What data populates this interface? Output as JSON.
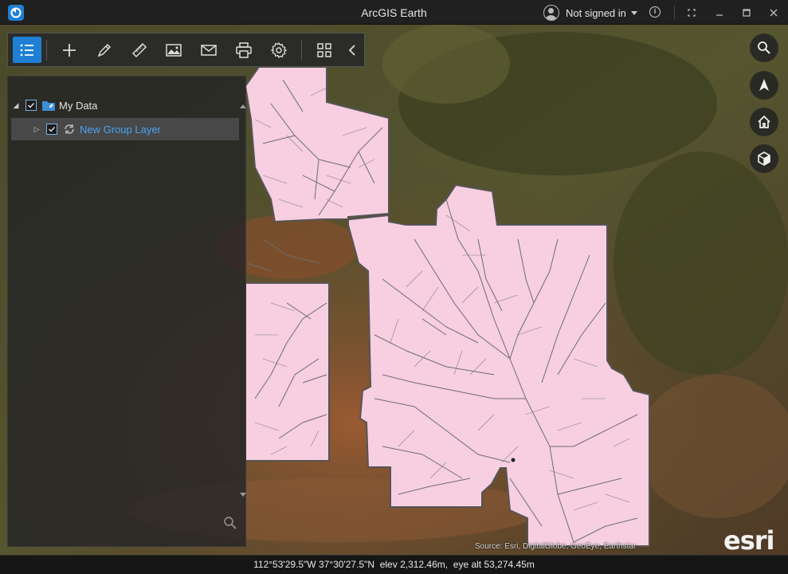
{
  "window": {
    "title": "ArcGIS Earth",
    "user_label": "Not signed in"
  },
  "toolbar": {
    "items": [
      "layers-icon",
      "add-icon",
      "draw-icon",
      "measure-icon",
      "image-icon",
      "mail-icon",
      "print-icon",
      "settings-icon",
      "grid-icon",
      "collapse-icon"
    ],
    "accent": "#1f7fd4"
  },
  "layers": {
    "root": {
      "label": "My Data",
      "checked": true
    },
    "child": {
      "label": "New Group Layer",
      "checked": true
    }
  },
  "nav": [
    "search-icon",
    "compass-icon",
    "home-icon",
    "3d-view-icon"
  ],
  "map": {
    "attribution": "Source: Esri, DigitalGlobe, GeoEye, Earthstar",
    "logo": "esri",
    "polygon_fill": "#f7cfe0",
    "stream_color": "#6d6d6d"
  },
  "status": {
    "coordinates": "112°53'29.5\"W 37°30'27.5\"N",
    "elevation": "elev 2,312.46m,",
    "eye_altitude": "eye alt 53,274.45m"
  }
}
